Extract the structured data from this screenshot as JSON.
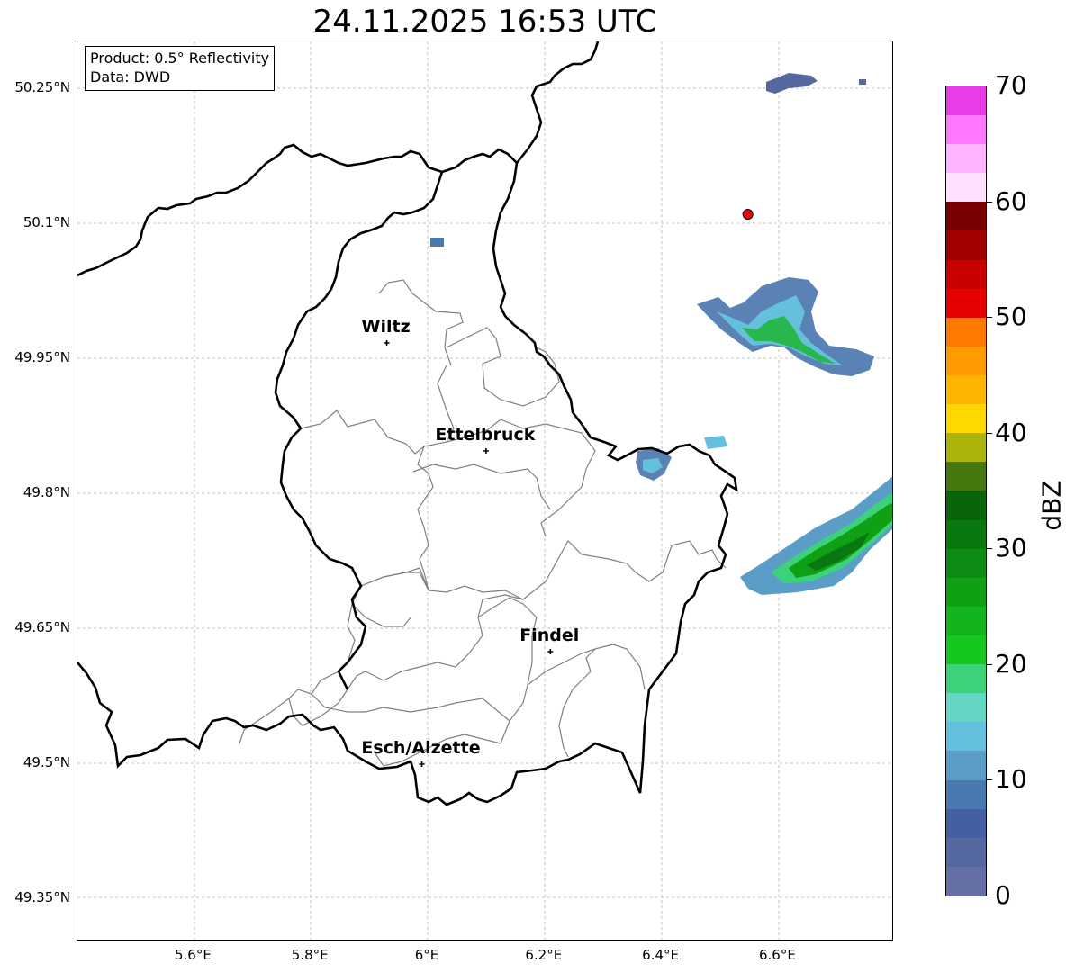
{
  "title": "24.11.2025 16:53 UTC",
  "info_box": {
    "product": "Product: 0.5° Reflectivity",
    "data": "Data: DWD"
  },
  "lat_ticks": [
    "50.25°N",
    "50.1°N",
    "49.95°N",
    "49.8°N",
    "49.65°N",
    "49.5°N",
    "49.35°N"
  ],
  "lon_ticks": [
    "5.6°E",
    "5.8°E",
    "6°E",
    "6.2°E",
    "6.4°E",
    "6.6°E"
  ],
  "cities": [
    {
      "name": "Wiltz",
      "lon": 5.93,
      "lat": 49.967
    },
    {
      "name": "Ettelbruck",
      "lon": 6.1,
      "lat": 49.847
    },
    {
      "name": "Findel",
      "lon": 6.21,
      "lat": 49.624
    },
    {
      "name": "Esch/Alzette",
      "lon": 5.99,
      "lat": 49.499
    }
  ],
  "radar_site": {
    "lon": 6.548,
    "lat": 50.11,
    "color": "#e01010"
  },
  "colorbar": {
    "unit": "dBZ",
    "tick_labels": [
      "0",
      "10",
      "20",
      "30",
      "40",
      "50",
      "60",
      "70"
    ],
    "min": 0,
    "max": 70,
    "colors": [
      "#6470a4",
      "#5568a0",
      "#4560a2",
      "#4a78b0",
      "#5a9ec8",
      "#64c0dc",
      "#64d6c4",
      "#3cd27a",
      "#14c81e",
      "#14b41e",
      "#10a014",
      "#0c8c14",
      "#0a7810",
      "#0a640c",
      "#467810",
      "#aab40a",
      "#ffd800",
      "#ffb400",
      "#ff9a00",
      "#ff7800",
      "#e60000",
      "#c80000",
      "#a00000",
      "#780000",
      "#ffe0ff",
      "#ffb4ff",
      "#ff78ff",
      "#e83ce8"
    ]
  },
  "colors": {
    "border": "#000000",
    "districts": "#808080",
    "grid": "#b0b0b0"
  }
}
